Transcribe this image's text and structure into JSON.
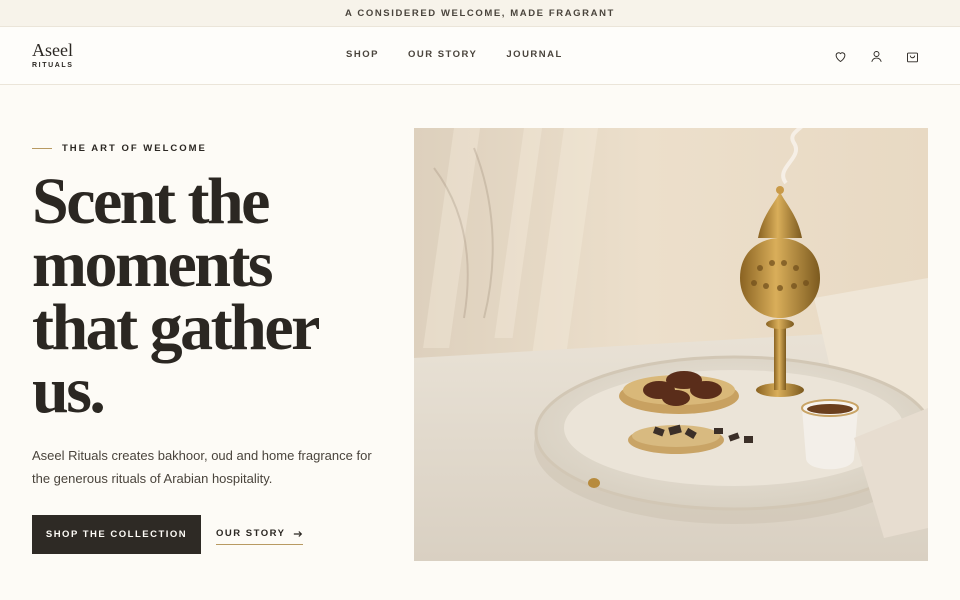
{
  "announcement": "A CONSIDERED WELCOME, MADE FRAGRANT",
  "brand": {
    "name": "Aseel",
    "sub": "RITUALS"
  },
  "nav": [
    "SHOP",
    "OUR STORY",
    "JOURNAL"
  ],
  "header_icons": [
    "heart-icon",
    "user-icon",
    "bag-icon"
  ],
  "hero": {
    "eyebrow": "THE ART OF WELCOME",
    "headline_lines": [
      "Scent the",
      "moments",
      "that gather",
      "us."
    ],
    "lead": "Aseel Rituals creates bakhoor, oud and home fragrance for the generous rituals of Arabian hospitality.",
    "cta_primary": "SHOP THE COLLECTION",
    "cta_secondary": "OUR STORY"
  },
  "colors": {
    "background": "#fdfbf6",
    "ink": "#2b2722",
    "accent": "#b89a62",
    "button": "#2e2a25"
  }
}
